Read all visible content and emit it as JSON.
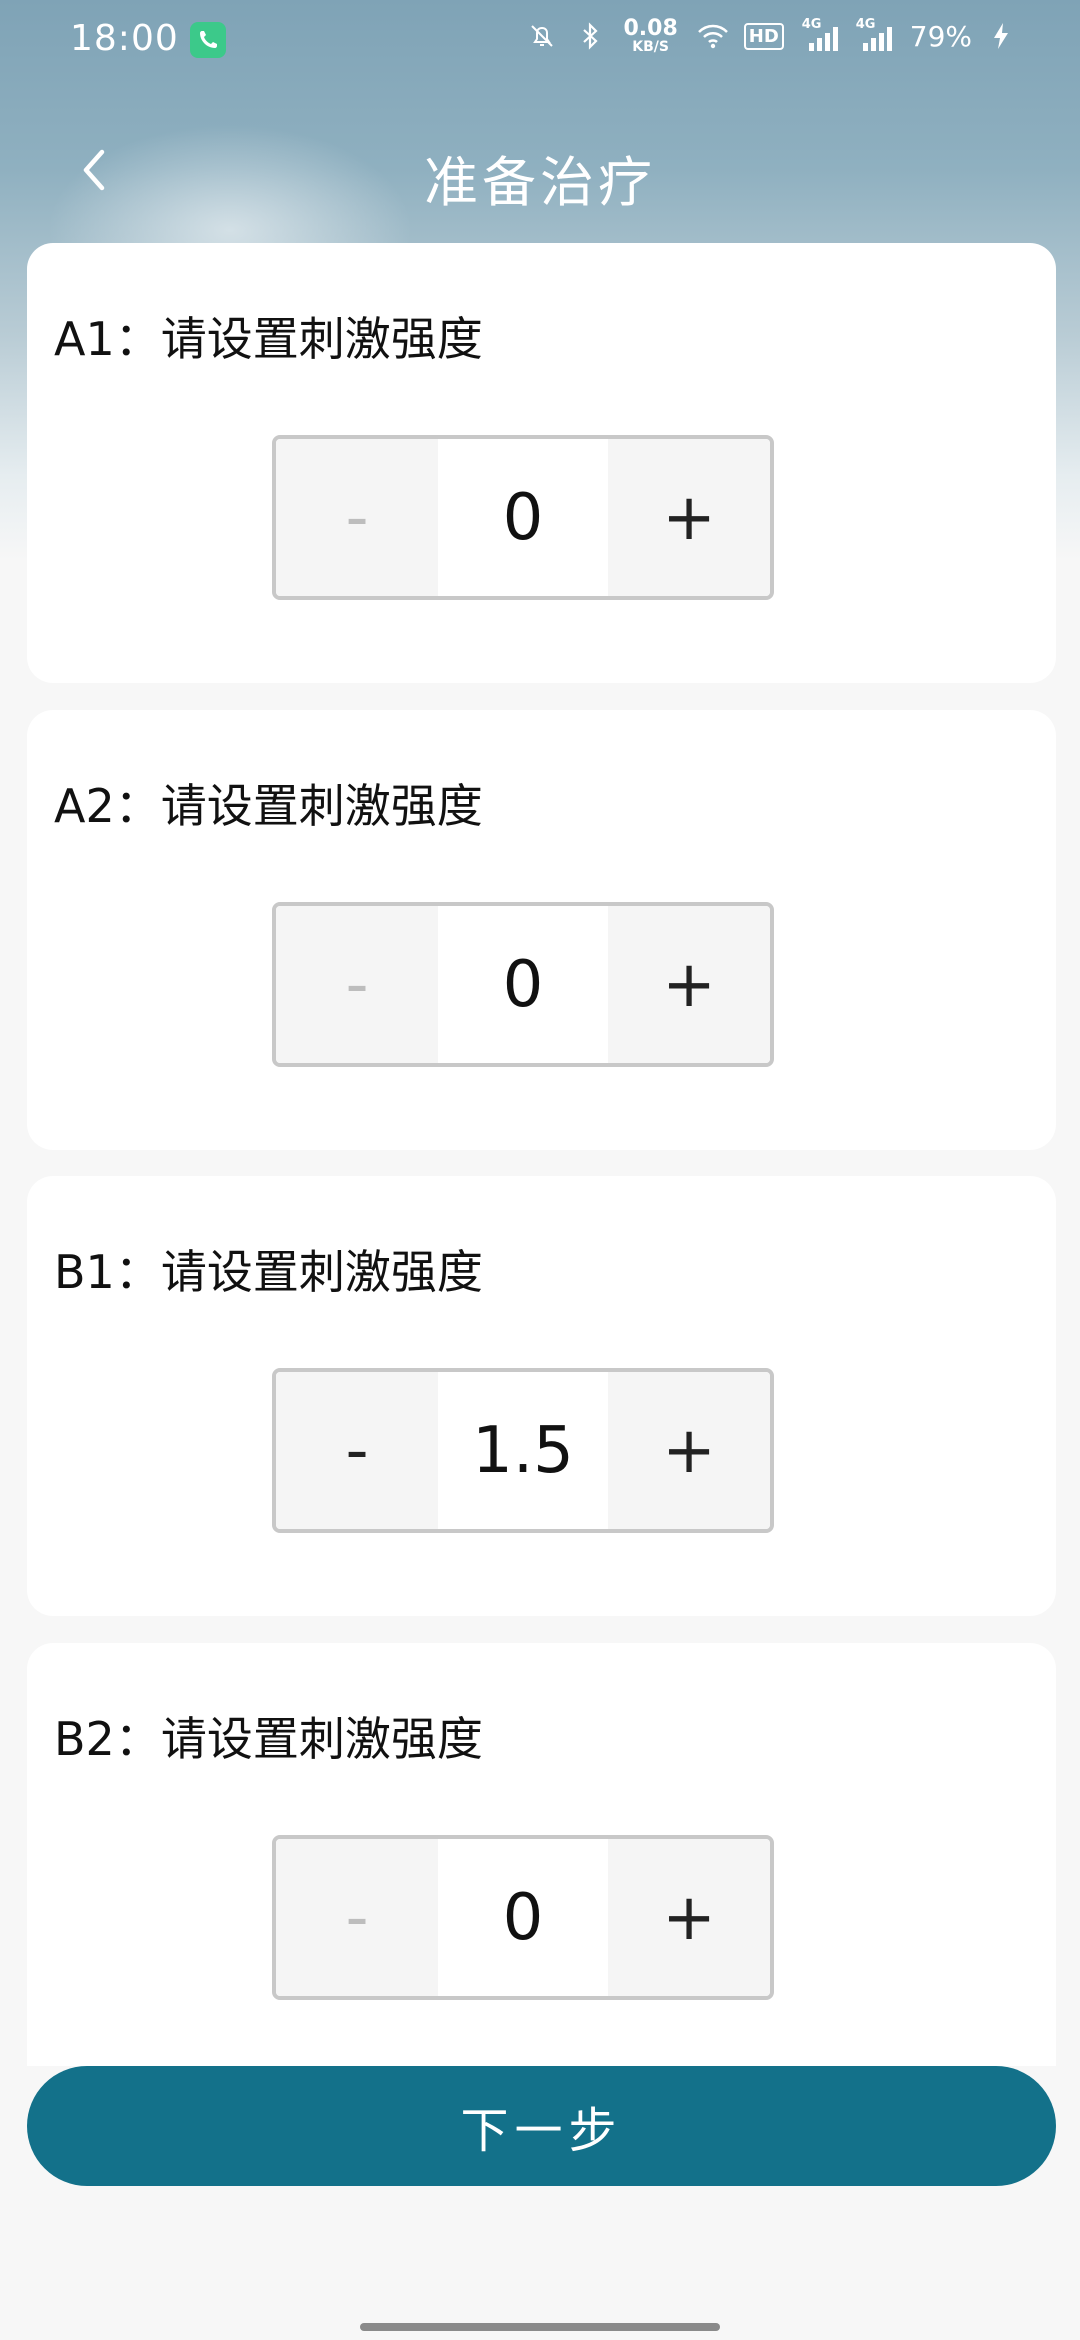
{
  "status_bar": {
    "time": "18:00",
    "net_speed_value": "0.08",
    "net_speed_unit": "KB/S",
    "hd_label": "HD",
    "signal1_label": "4G",
    "signal2_label": "4G",
    "battery": "79%"
  },
  "nav": {
    "title": "准备治疗"
  },
  "channels": [
    {
      "label": "A1：请设置刺激强度",
      "value": "0",
      "minus": "-",
      "plus": "+",
      "minus_enabled": false
    },
    {
      "label": "A2：请设置刺激强度",
      "value": "0",
      "minus": "-",
      "plus": "+",
      "minus_enabled": false
    },
    {
      "label": "B1：请设置刺激强度",
      "value": "1.5",
      "minus": "-",
      "plus": "+",
      "minus_enabled": true
    },
    {
      "label": "B2：请设置刺激强度",
      "value": "0",
      "minus": "-",
      "plus": "+",
      "minus_enabled": false
    }
  ],
  "footer": {
    "next_label": "下一步"
  },
  "colors": {
    "primary": "#13718a",
    "card_bg": "#ffffff",
    "page_bg": "#f7f7f7"
  }
}
